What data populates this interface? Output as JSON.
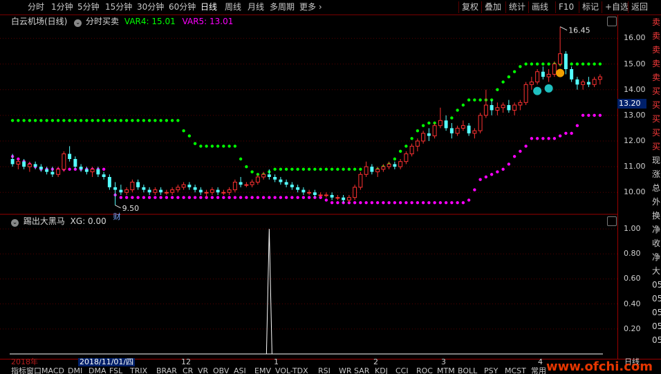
{
  "toolbar": {
    "left_items": [
      "分时",
      "1分钟",
      "5分钟",
      "15分钟",
      "30分钟",
      "60分钟",
      "日线",
      "周线",
      "月线",
      "多周期",
      "更多"
    ],
    "active_item": "日线",
    "right_items": [
      "复权",
      "叠加",
      "统计",
      "画线",
      "F10",
      "标记",
      "+自选",
      "返回"
    ]
  },
  "main_panel": {
    "stock_name": "白云机场(日线)",
    "indicator_name": "分时买卖",
    "var4_label": "VAR4: 15.01",
    "var5_label": "VAR5: 13.01",
    "high_label": "16.45",
    "low_label": "9.50",
    "finance_badge": "财",
    "current_price": "13.20",
    "price_ticks": [
      "16.00",
      "15.00",
      "14.00",
      "13.00",
      "12.00",
      "11.00",
      "10.00"
    ]
  },
  "sub_panel": {
    "indicator_name": "踢出大黑马",
    "xg_label": "XG: 0.00",
    "value_ticks": [
      "1.00",
      "0.80",
      "0.60",
      "0.40",
      "0.20"
    ]
  },
  "signals_column": [
    "卖",
    "卖",
    "卖",
    "卖",
    "卖",
    "买",
    "买",
    "买",
    "买",
    "买",
    "现",
    "涨",
    "总",
    "外",
    "换",
    "净",
    "收",
    "净",
    "大",
    "05",
    "05",
    "05",
    "05",
    "05"
  ],
  "date_axis": {
    "year_label": "2018年",
    "selected_date": "2018/11/01/四",
    "month_labels": [
      "12",
      "1",
      "2",
      "3",
      "4"
    ],
    "period_label": "日线"
  },
  "bottom_tabs": [
    "指标",
    "窗口",
    "MACD",
    "DMI",
    "DMA",
    "FSL",
    "TRIX",
    "BRAR",
    "CR",
    "VR",
    "OBV",
    "ASI",
    "EMV",
    "VOL-TDX",
    "RSI",
    "WR",
    "SAR",
    "KDJ",
    "CCI",
    "ROC",
    "MTM",
    "BOLL",
    "PSY",
    "MCST",
    "常用"
  ],
  "watermark": "www.ofchi.com",
  "colors": {
    "up": "#ff3232",
    "down": "#54ffff",
    "var4": "#00ff00",
    "var5": "#ff00ff",
    "grid": "#9b0000"
  },
  "chart_data": {
    "type": "candlestick",
    "ohlc": [
      [
        11.3,
        11.5,
        11.0,
        11.1
      ],
      [
        11.1,
        11.3,
        10.9,
        11.2
      ],
      [
        11.2,
        11.3,
        10.9,
        11.0
      ],
      [
        11.0,
        11.2,
        10.8,
        11.1
      ],
      [
        11.1,
        11.2,
        10.9,
        11.0
      ],
      [
        11.0,
        11.1,
        10.8,
        10.9
      ],
      [
        10.9,
        11.0,
        10.7,
        10.8
      ],
      [
        10.8,
        11.0,
        10.6,
        10.7
      ],
      [
        10.7,
        11.0,
        10.6,
        10.9
      ],
      [
        10.9,
        11.6,
        10.8,
        11.5
      ],
      [
        11.5,
        11.8,
        11.2,
        11.3
      ],
      [
        11.3,
        11.4,
        10.9,
        11.0
      ],
      [
        11.0,
        11.1,
        10.8,
        10.9
      ],
      [
        10.9,
        11.0,
        10.7,
        10.8
      ],
      [
        10.8,
        11.0,
        10.6,
        10.9
      ],
      [
        10.9,
        11.0,
        10.6,
        10.7
      ],
      [
        10.7,
        10.8,
        10.5,
        10.6
      ],
      [
        10.6,
        10.7,
        10.1,
        10.2
      ],
      [
        10.2,
        10.4,
        9.5,
        10.1
      ],
      [
        10.1,
        10.3,
        9.9,
        10.0
      ],
      [
        10.0,
        10.2,
        9.9,
        10.1
      ],
      [
        10.1,
        10.5,
        10.0,
        10.4
      ],
      [
        10.4,
        10.5,
        10.1,
        10.2
      ],
      [
        10.2,
        10.3,
        10.0,
        10.1
      ],
      [
        10.1,
        10.2,
        9.9,
        10.0
      ],
      [
        10.0,
        10.2,
        9.9,
        10.1
      ],
      [
        10.1,
        10.2,
        9.9,
        10.0
      ],
      [
        10.0,
        10.1,
        9.9,
        10.0
      ],
      [
        10.0,
        10.2,
        9.9,
        10.1
      ],
      [
        10.1,
        10.3,
        10.0,
        10.2
      ],
      [
        10.2,
        10.4,
        10.1,
        10.3
      ],
      [
        10.3,
        10.4,
        10.1,
        10.2
      ],
      [
        10.2,
        10.3,
        10.0,
        10.1
      ],
      [
        10.1,
        10.2,
        9.9,
        10.0
      ],
      [
        10.0,
        10.1,
        9.8,
        10.0
      ],
      [
        10.0,
        10.2,
        9.9,
        10.1
      ],
      [
        10.1,
        10.2,
        9.9,
        10.0
      ],
      [
        10.0,
        10.1,
        9.9,
        10.0
      ],
      [
        10.0,
        10.2,
        9.9,
        10.1
      ],
      [
        10.1,
        10.5,
        10.0,
        10.4
      ],
      [
        10.4,
        10.6,
        10.2,
        10.3
      ],
      [
        10.3,
        10.4,
        10.2,
        10.3
      ],
      [
        10.3,
        10.5,
        10.2,
        10.4
      ],
      [
        10.4,
        10.7,
        10.3,
        10.6
      ],
      [
        10.6,
        10.8,
        10.5,
        10.7
      ],
      [
        10.7,
        10.9,
        10.5,
        10.6
      ],
      [
        10.6,
        10.7,
        10.4,
        10.5
      ],
      [
        10.5,
        10.6,
        10.3,
        10.4
      ],
      [
        10.4,
        10.5,
        10.2,
        10.3
      ],
      [
        10.3,
        10.4,
        10.1,
        10.2
      ],
      [
        10.2,
        10.3,
        10.0,
        10.1
      ],
      [
        10.1,
        10.2,
        9.9,
        10.0
      ],
      [
        10.0,
        10.1,
        9.9,
        10.0
      ],
      [
        10.0,
        10.1,
        9.8,
        9.9
      ],
      [
        9.9,
        10.0,
        9.8,
        9.9
      ],
      [
        9.9,
        10.0,
        9.8,
        9.9
      ],
      [
        9.9,
        10.0,
        9.7,
        9.8
      ],
      [
        9.8,
        9.9,
        9.7,
        9.8
      ],
      [
        9.8,
        9.9,
        9.6,
        9.7
      ],
      [
        9.7,
        9.9,
        9.6,
        9.8
      ],
      [
        9.8,
        10.3,
        9.7,
        10.2
      ],
      [
        10.2,
        10.8,
        10.1,
        10.7
      ],
      [
        10.7,
        11.2,
        10.6,
        11.0
      ],
      [
        11.0,
        11.1,
        10.7,
        10.8
      ],
      [
        10.8,
        11.0,
        10.6,
        10.9
      ],
      [
        10.9,
        11.1,
        10.8,
        11.0
      ],
      [
        11.0,
        11.2,
        10.9,
        11.1
      ],
      [
        11.1,
        11.2,
        10.9,
        11.0
      ],
      [
        11.0,
        11.3,
        10.9,
        11.2
      ],
      [
        11.2,
        11.6,
        11.1,
        11.5
      ],
      [
        11.5,
        11.9,
        11.4,
        11.8
      ],
      [
        11.8,
        12.1,
        11.6,
        12.0
      ],
      [
        12.0,
        12.4,
        11.9,
        12.3
      ],
      [
        12.3,
        12.5,
        12.0,
        12.2
      ],
      [
        12.2,
        12.7,
        12.1,
        12.6
      ],
      [
        12.6,
        13.3,
        12.5,
        12.8
      ],
      [
        12.8,
        13.0,
        12.4,
        12.5
      ],
      [
        12.5,
        12.7,
        12.1,
        12.3
      ],
      [
        12.3,
        12.6,
        12.2,
        12.5
      ],
      [
        12.5,
        12.8,
        12.4,
        12.6
      ],
      [
        12.6,
        12.7,
        12.2,
        12.3
      ],
      [
        12.3,
        12.5,
        12.1,
        12.4
      ],
      [
        12.4,
        13.1,
        12.3,
        13.0
      ],
      [
        13.0,
        14.0,
        12.9,
        13.4
      ],
      [
        13.4,
        13.6,
        13.0,
        13.2
      ],
      [
        13.2,
        13.5,
        13.0,
        13.3
      ],
      [
        13.3,
        13.5,
        13.1,
        13.4
      ],
      [
        13.4,
        13.6,
        13.1,
        13.2
      ],
      [
        13.2,
        13.5,
        13.0,
        13.4
      ],
      [
        13.4,
        13.6,
        13.2,
        13.5
      ],
      [
        13.5,
        14.3,
        13.4,
        14.2
      ],
      [
        14.2,
        14.5,
        14.0,
        14.3
      ],
      [
        14.3,
        14.8,
        14.2,
        14.7
      ],
      [
        14.7,
        14.9,
        14.4,
        14.5
      ],
      [
        14.5,
        14.8,
        14.3,
        14.6
      ],
      [
        14.6,
        15.1,
        14.5,
        15.0
      ],
      [
        15.0,
        16.45,
        14.9,
        15.4
      ],
      [
        15.4,
        15.5,
        14.6,
        14.8
      ],
      [
        14.8,
        14.9,
        14.3,
        14.4
      ],
      [
        14.4,
        14.5,
        14.0,
        14.2
      ],
      [
        14.2,
        14.4,
        14.0,
        14.3
      ],
      [
        14.3,
        14.5,
        14.1,
        14.2
      ],
      [
        14.2,
        14.5,
        14.1,
        14.4
      ],
      [
        14.4,
        14.6,
        14.2,
        14.5
      ]
    ],
    "var4": [
      12.8,
      12.8,
      12.8,
      12.8,
      12.8,
      12.8,
      12.8,
      12.8,
      12.8,
      12.8,
      12.8,
      12.8,
      12.8,
      12.8,
      12.8,
      12.8,
      12.8,
      12.8,
      12.8,
      12.8,
      12.8,
      12.8,
      12.8,
      12.8,
      12.8,
      12.8,
      12.8,
      12.8,
      12.8,
      12.8,
      12.4,
      12.2,
      11.9,
      11.8,
      11.8,
      11.8,
      11.8,
      11.8,
      11.8,
      11.8,
      11.3,
      11.0,
      10.8,
      10.7,
      10.7,
      10.8,
      10.9,
      10.9,
      10.9,
      10.9,
      10.9,
      10.9,
      10.9,
      10.9,
      10.9,
      10.9,
      10.9,
      10.9,
      10.9,
      10.9,
      10.9,
      10.9,
      10.9,
      10.9,
      10.9,
      11.0,
      11.1,
      11.3,
      11.6,
      11.8,
      12.1,
      12.4,
      12.6,
      12.7,
      12.7,
      12.7,
      12.7,
      12.9,
      13.2,
      13.4,
      13.6,
      13.6,
      13.6,
      13.6,
      13.6,
      14.0,
      14.3,
      14.5,
      14.7,
      14.9,
      15.0,
      15.0,
      15.0,
      15.0,
      15.0,
      15.0,
      15.0,
      15.0,
      15.0,
      15.0,
      15.0,
      15.0,
      15.0,
      15.0
    ],
    "var5": [
      11.4,
      11.3,
      11.2,
      11.1,
      11.0,
      10.9,
      10.9,
      10.9,
      10.9,
      10.9,
      10.9,
      10.9,
      10.9,
      10.9,
      10.9,
      10.9,
      10.9,
      10.3,
      9.9,
      9.8,
      9.8,
      9.8,
      9.8,
      9.8,
      9.8,
      9.8,
      9.8,
      9.8,
      9.8,
      9.8,
      9.8,
      9.8,
      9.8,
      9.8,
      9.8,
      9.8,
      9.8,
      9.8,
      9.8,
      9.8,
      9.8,
      9.8,
      9.8,
      9.8,
      9.8,
      9.8,
      9.8,
      9.8,
      9.8,
      9.8,
      9.8,
      9.8,
      9.8,
      9.8,
      9.8,
      9.7,
      9.6,
      9.6,
      9.6,
      9.6,
      9.6,
      9.6,
      9.6,
      9.6,
      9.6,
      9.6,
      9.6,
      9.6,
      9.6,
      9.6,
      9.6,
      9.6,
      9.6,
      9.6,
      9.6,
      9.6,
      9.6,
      9.6,
      9.6,
      9.6,
      9.7,
      10.1,
      10.5,
      10.6,
      10.7,
      10.8,
      10.9,
      11.1,
      11.4,
      11.6,
      11.8,
      12.1,
      12.1,
      12.1,
      12.1,
      12.1,
      12.2,
      12.3,
      12.3,
      12.6,
      13.0,
      13.0,
      13.0,
      13.0
    ],
    "xg": {
      "spike_index": 45,
      "spike_value": 1.0
    },
    "ylim": [
      9.2,
      16.9
    ],
    "ylim_sub": [
      0,
      1.1
    ]
  }
}
